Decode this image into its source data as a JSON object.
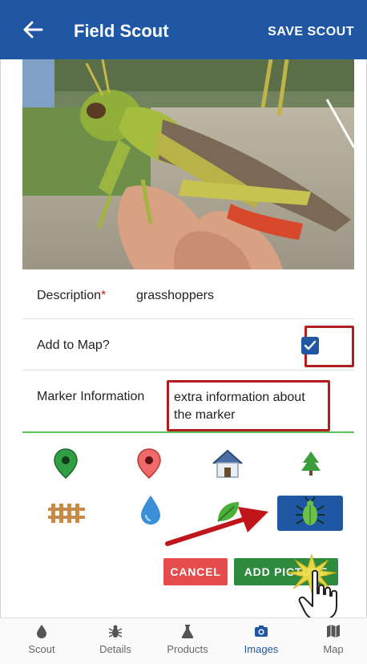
{
  "app_bar": {
    "title": "Field Scout",
    "save_label": "SAVE SCOUT"
  },
  "photo": {
    "subject": "grasshopper"
  },
  "form": {
    "description_label": "Description",
    "required_mark": "*",
    "description_value": "grasshoppers",
    "add_to_map_label": "Add to Map?",
    "add_to_map_checked": true,
    "marker_info_label": "Marker Information",
    "marker_info_value": "extra information about the marker"
  },
  "marker_icons": [
    {
      "name": "green-pin-icon"
    },
    {
      "name": "red-pin-icon"
    },
    {
      "name": "house-icon"
    },
    {
      "name": "tree-icon"
    },
    {
      "name": "fence-icon"
    },
    {
      "name": "water-drop-icon"
    },
    {
      "name": "leaf-icon"
    },
    {
      "name": "bug-icon",
      "selected": true
    }
  ],
  "buttons": {
    "cancel": "CANCEL",
    "add_picture": "ADD PICTURE"
  },
  "bottom_nav": [
    {
      "label": "Scout",
      "icon": "drop-icon"
    },
    {
      "label": "Details",
      "icon": "bug-icon"
    },
    {
      "label": "Products",
      "icon": "flask-icon"
    },
    {
      "label": "Images",
      "icon": "camera-icon",
      "active": true
    },
    {
      "label": "Map",
      "icon": "map-icon"
    }
  ],
  "colors": {
    "primary": "#1f57a4",
    "danger": "#e74c4c",
    "success": "#2e8b3e",
    "annotation": "#b01e1e",
    "active_underline": "#5cc25c"
  }
}
